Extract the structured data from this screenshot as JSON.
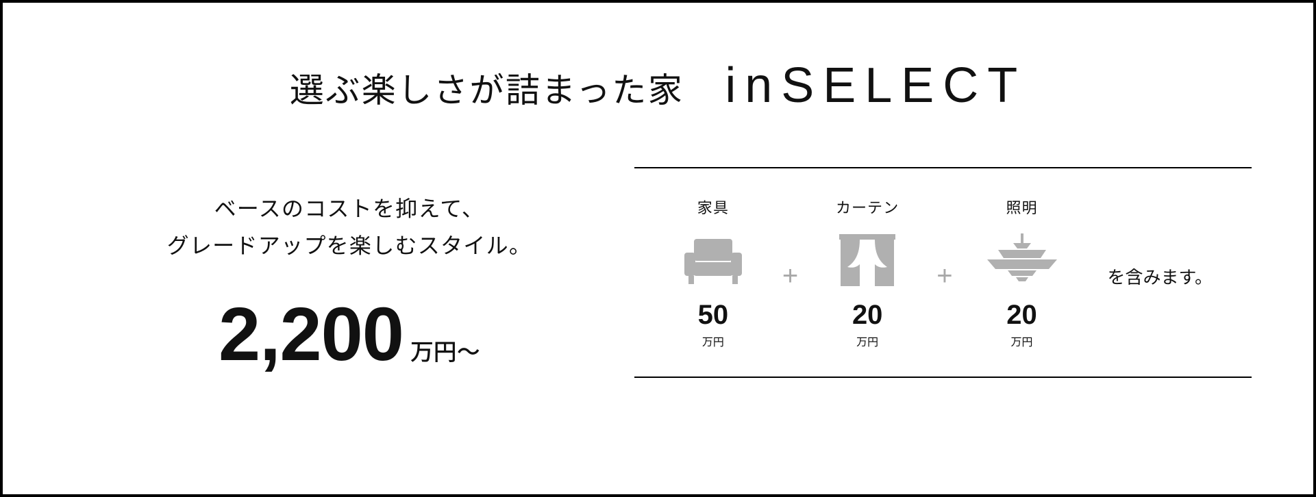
{
  "headline": {
    "tagline": "選ぶ楽しさが詰まった家",
    "brand": "inSELECT"
  },
  "subcopy": {
    "line1": "ベースのコストを抑えて、",
    "line2": "グレードアップを楽しむスタイル。"
  },
  "price": {
    "amount": "2,200",
    "unit": "万円〜"
  },
  "inclusions": {
    "items": [
      {
        "label": "家具",
        "amount": "50",
        "unit": "万円",
        "icon": "sofa-icon"
      },
      {
        "label": "カーテン",
        "amount": "20",
        "unit": "万円",
        "icon": "curtain-icon"
      },
      {
        "label": "照明",
        "amount": "20",
        "unit": "万円",
        "icon": "pendant-light-icon"
      }
    ],
    "separator": "+",
    "note": "を含みます。"
  },
  "colors": {
    "iconGray": "#b0b0b0",
    "border": "#000000",
    "text": "#111111"
  }
}
